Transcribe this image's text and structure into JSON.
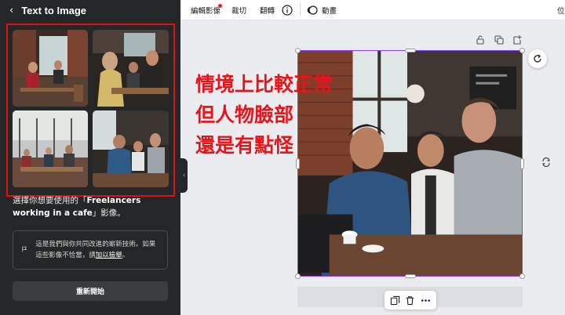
{
  "panel": {
    "back_icon": "‹",
    "title": "Text to Image",
    "description_prefix": "選擇你想要使用的「",
    "description_query": "Freelancers working in a cafe",
    "description_suffix": "」影像。",
    "notice_text": "這是我們與你共同改進的嶄新技術。如果這些影像不恰當，請",
    "notice_link": "加以檢舉",
    "notice_end": "。",
    "restart_label": "重新開始",
    "collapse_icon": "‹"
  },
  "toolbar": {
    "edit_image": "編輯影像",
    "crop": "裁切",
    "flip": "翻轉",
    "animate": "動畫",
    "position": "位"
  },
  "annotation": {
    "line1": "情境上比較正常",
    "line2": "但人物臉部",
    "line3": "還是有點怪"
  },
  "colors": {
    "panel_bg": "#252627",
    "highlight_border": "#e01010",
    "annotation_red": "#e8141a",
    "selection": "#8b3dff",
    "notification_dot": "#e2231a"
  }
}
